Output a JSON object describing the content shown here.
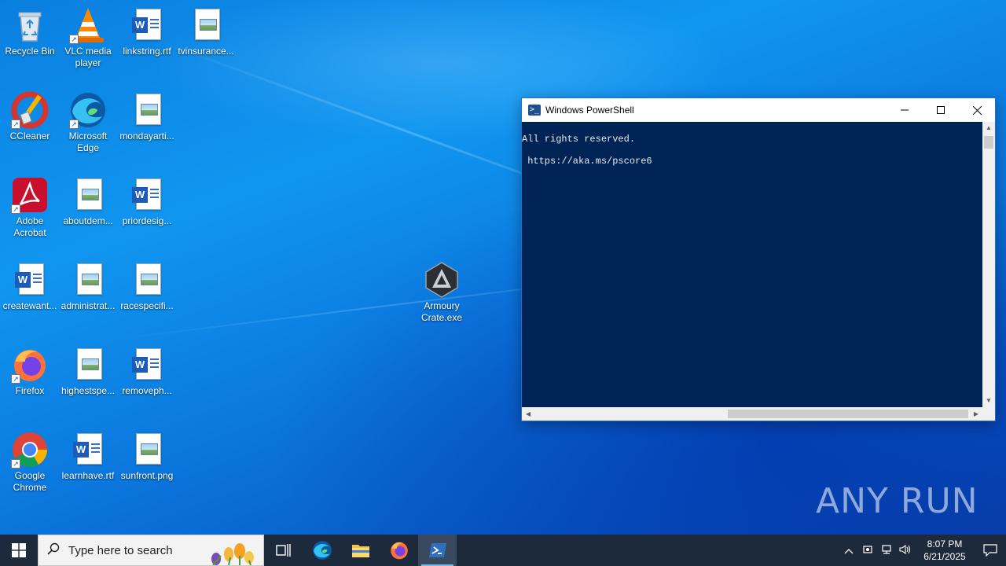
{
  "desktop": {
    "icons": [
      {
        "label": "Recycle Bin"
      },
      {
        "label": "VLC media player"
      },
      {
        "label": "linkstring.rtf"
      },
      {
        "label": "tvinsurance..."
      },
      {
        "label": "CCleaner"
      },
      {
        "label": "Microsoft Edge"
      },
      {
        "label": "mondayarti..."
      },
      {
        "label": "Adobe Acrobat"
      },
      {
        "label": "aboutdem..."
      },
      {
        "label": "priordesig..."
      },
      {
        "label": "createwant..."
      },
      {
        "label": "administrat..."
      },
      {
        "label": "racespecifi..."
      },
      {
        "label": "Armoury Crate.exe"
      },
      {
        "label": "Firefox"
      },
      {
        "label": "highestspe..."
      },
      {
        "label": "removeph..."
      },
      {
        "label": "Google Chrome"
      },
      {
        "label": "learnhave.rtf"
      },
      {
        "label": "sunfront.png"
      }
    ]
  },
  "powershell": {
    "title": "Windows PowerShell",
    "icon": "powershell-icon",
    "console_text": "All rights reserved.\n\n https://aka.ms/pscore6",
    "background_color": "#012456"
  },
  "watermark": {
    "text": "ANY RUN"
  },
  "taskbar": {
    "search_placeholder": "Type here to search",
    "apps": [
      "task-view-icon",
      "edge-icon",
      "file-explorer-icon",
      "firefox-icon",
      "powershell-icon"
    ],
    "clock": {
      "time": "8:07 PM",
      "date": "6/21/2025"
    }
  }
}
